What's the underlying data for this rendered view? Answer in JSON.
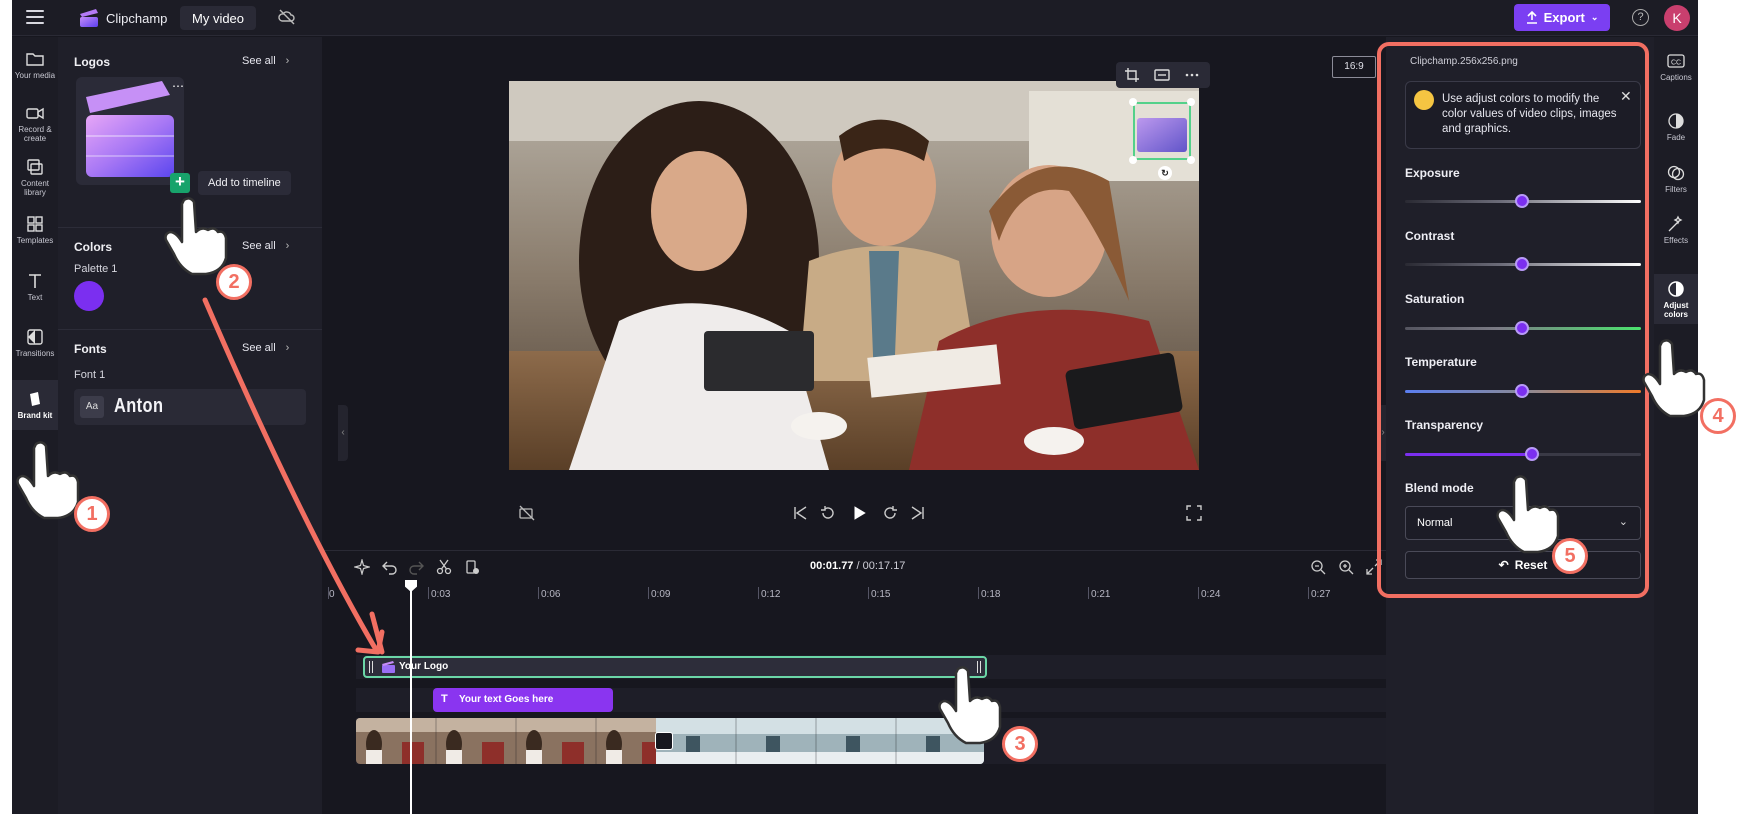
{
  "topbar": {
    "app_name": "Clipchamp",
    "video_name": "My video",
    "export_label": "Export",
    "help_glyph": "?",
    "avatar_initial": "K"
  },
  "left_rail": [
    {
      "label": "Your media",
      "icon": "folder-icon"
    },
    {
      "label": "Record & create",
      "icon": "camera-icon"
    },
    {
      "label": "Content library",
      "icon": "library-icon"
    },
    {
      "label": "Templates",
      "icon": "templates-icon"
    },
    {
      "label": "Text",
      "icon": "text-icon"
    },
    {
      "label": "Transitions",
      "icon": "transitions-icon"
    },
    {
      "label": "Brand kit",
      "icon": "brand-kit-icon",
      "active": true
    }
  ],
  "brand_panel": {
    "logos_title": "Logos",
    "colors_title": "Colors",
    "fonts_title": "Fonts",
    "see_all": "See all",
    "add_to_timeline": "Add to timeline",
    "palette_label": "Palette 1",
    "palette_color": "#7b2ff0",
    "font_label": "Font 1",
    "font_sample_prefix": "Aa",
    "font_name": "Anton"
  },
  "preview": {
    "aspect_ratio": "16:9"
  },
  "timeline": {
    "current_time": "00:01.77",
    "separator": " / ",
    "total_time": "00:17.17",
    "ruler": [
      "0",
      "0:03",
      "0:06",
      "0:09",
      "0:12",
      "0:15",
      "0:18",
      "0:21",
      "0:24",
      "0:27"
    ],
    "logo_clip_label": "Your Logo",
    "text_clip_icon": "T",
    "text_clip_label": "Your text Goes here"
  },
  "adjust_panel": {
    "file_name": "Clipchamp.256x256.png",
    "tip": "Use adjust colors to modify the color values of video clips, images and graphics.",
    "sliders": [
      {
        "label": "Exposure",
        "value": 0.5
      },
      {
        "label": "Contrast",
        "value": 0.5
      },
      {
        "label": "Saturation",
        "value": 0.5
      },
      {
        "label": "Temperature",
        "value": 0.5
      },
      {
        "label": "Transparency",
        "value": 0.54
      }
    ],
    "blend_mode_label": "Blend mode",
    "blend_mode_value": "Normal",
    "reset_label": "Reset"
  },
  "right_rail": [
    {
      "label": "Captions",
      "icon": "captions-icon"
    },
    {
      "label": "Fade",
      "icon": "fade-icon"
    },
    {
      "label": "Filters",
      "icon": "filters-icon"
    },
    {
      "label": "Effects",
      "icon": "effects-icon"
    },
    {
      "label": "Adjust colors",
      "icon": "adjust-colors-icon",
      "active": true
    }
  ],
  "annotations": [
    "1",
    "2",
    "3",
    "4",
    "5"
  ],
  "colors": {
    "accent": "#7b3ff2",
    "annotation": "#f26f62",
    "selection": "#53d18a"
  }
}
